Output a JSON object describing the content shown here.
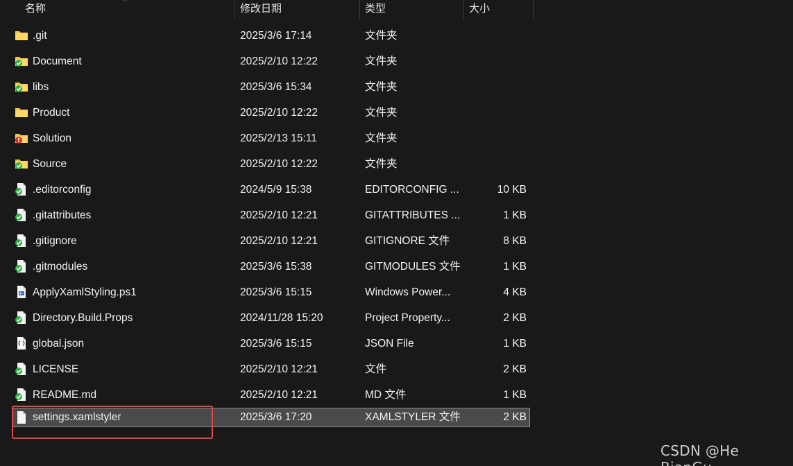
{
  "columns": {
    "name": "名称",
    "modified": "修改日期",
    "type": "类型",
    "size": "大小",
    "sort_indicator": "^"
  },
  "files": [
    {
      "name": ".git",
      "modified": "2025/3/6 17:14",
      "type": "文件夹",
      "size": "",
      "icon": "folder-icon"
    },
    {
      "name": "Document",
      "modified": "2025/2/10 12:22",
      "type": "文件夹",
      "size": "",
      "icon": "folder-synced-icon"
    },
    {
      "name": "libs",
      "modified": "2025/3/6 15:34",
      "type": "文件夹",
      "size": "",
      "icon": "folder-synced-icon"
    },
    {
      "name": "Product",
      "modified": "2025/2/10 12:22",
      "type": "文件夹",
      "size": "",
      "icon": "folder-icon"
    },
    {
      "name": "Solution",
      "modified": "2025/2/13 15:11",
      "type": "文件夹",
      "size": "",
      "icon": "folder-conflict-icon"
    },
    {
      "name": "Source",
      "modified": "2025/2/10 12:22",
      "type": "文件夹",
      "size": "",
      "icon": "folder-synced-icon"
    },
    {
      "name": ".editorconfig",
      "modified": "2024/5/9 15:38",
      "type": "EDITORCONFIG ...",
      "size": "10 KB",
      "icon": "file-synced-icon"
    },
    {
      "name": ".gitattributes",
      "modified": "2025/2/10 12:21",
      "type": "GITATTRIBUTES ...",
      "size": "1 KB",
      "icon": "file-synced-icon"
    },
    {
      "name": ".gitignore",
      "modified": "2025/2/10 12:21",
      "type": "GITIGNORE 文件",
      "size": "8 KB",
      "icon": "file-synced-icon"
    },
    {
      "name": ".gitmodules",
      "modified": "2025/3/6 15:38",
      "type": "GITMODULES 文件",
      "size": "1 KB",
      "icon": "file-synced-icon"
    },
    {
      "name": "ApplyXamlStyling.ps1",
      "modified": "2025/3/6 15:15",
      "type": "Windows Power...",
      "size": "4 KB",
      "icon": "powershell-file-icon"
    },
    {
      "name": "Directory.Build.Props",
      "modified": "2024/11/28 15:20",
      "type": "Project Property...",
      "size": "2 KB",
      "icon": "file-synced-icon"
    },
    {
      "name": "global.json",
      "modified": "2025/3/6 15:15",
      "type": "JSON File",
      "size": "1 KB",
      "icon": "json-file-icon"
    },
    {
      "name": "LICENSE",
      "modified": "2025/2/10 12:21",
      "type": "文件",
      "size": "2 KB",
      "icon": "file-synced-icon"
    },
    {
      "name": "README.md",
      "modified": "2025/2/10 12:21",
      "type": "MD 文件",
      "size": "1 KB",
      "icon": "file-synced-icon"
    },
    {
      "name": "settings.xamlstyler",
      "modified": "2025/3/6 17:20",
      "type": "XAMLSTYLER 文件",
      "size": "2 KB",
      "icon": "file-icon",
      "selected": true
    }
  ],
  "watermark": "CSDN @He BianGu",
  "colors": {
    "background": "#191919",
    "selection": "#4a4a4a",
    "highlight_box": "#e04a4a",
    "folder": "#f4c542",
    "sync_green": "#2fb344",
    "conflict_red": "#d93025"
  }
}
